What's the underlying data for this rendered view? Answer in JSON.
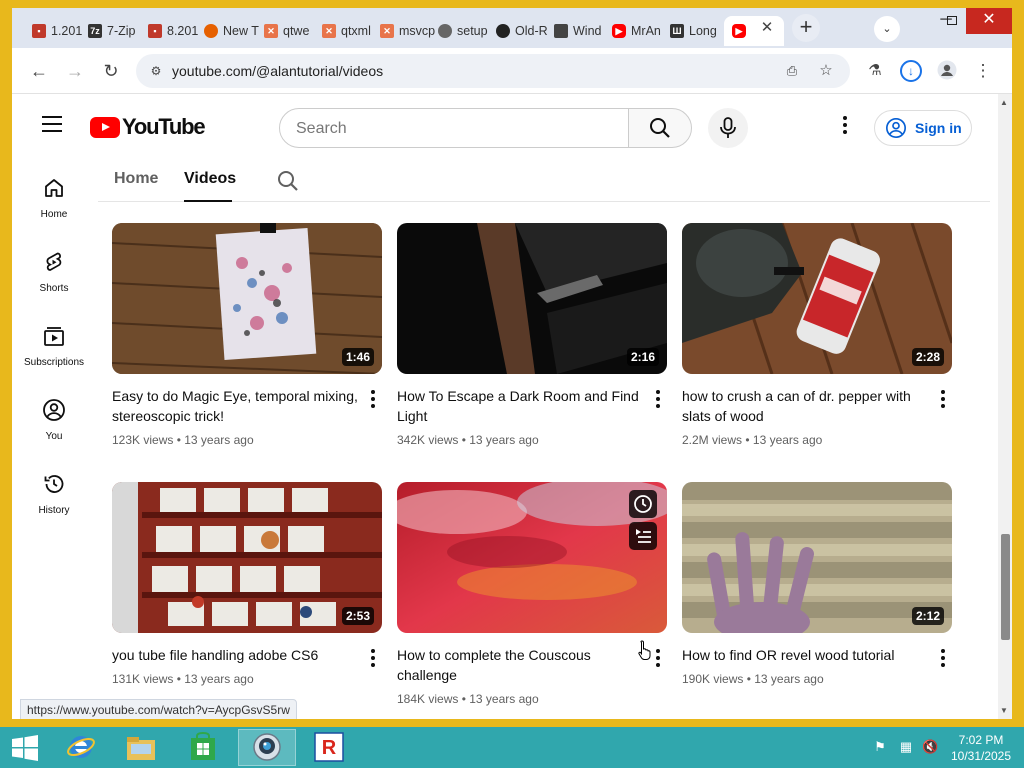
{
  "browser": {
    "tabs": [
      {
        "title": "1.201",
        "icon": "app-icon",
        "color": "#c0392b"
      },
      {
        "title": "7-Zip",
        "icon": "7zip-icon",
        "color": "#333333"
      },
      {
        "title": "8.201",
        "icon": "app-icon",
        "color": "#c0392b"
      },
      {
        "title": "New T",
        "icon": "firefox-icon",
        "color": "#e66000"
      },
      {
        "title": "qtwe",
        "icon": "package-icon",
        "color": "#e8744a"
      },
      {
        "title": "qtxml",
        "icon": "package-icon",
        "color": "#e8744a"
      },
      {
        "title": "msvcp",
        "icon": "package-icon",
        "color": "#e8744a"
      },
      {
        "title": "setup",
        "icon": "globe-icon",
        "color": "#666666"
      },
      {
        "title": "Old-R",
        "icon": "github-icon",
        "color": "#222222"
      },
      {
        "title": "Wind",
        "icon": "wayback-icon",
        "color": "#444444"
      },
      {
        "title": "MrAn",
        "icon": "youtube-icon",
        "color": "#ff0000"
      },
      {
        "title": "Long",
        "icon": "archive-icon",
        "color": "#333333"
      }
    ],
    "active_tab_icon": "youtube-icon",
    "new_tab_label": "+",
    "tab_search_label": "⌄",
    "url": "youtube.com/@alantutorial/videos",
    "status_url": "https://www.youtube.com/watch?v=AycpGsvS5rw"
  },
  "youtube": {
    "logo_text": "YouTube",
    "search_placeholder": "Search",
    "sign_in": "Sign in",
    "nav": [
      {
        "label": "Home",
        "icon": "home-icon"
      },
      {
        "label": "Shorts",
        "icon": "shorts-icon"
      },
      {
        "label": "Subscriptions",
        "icon": "subscriptions-icon"
      },
      {
        "label": "You",
        "icon": "you-icon"
      },
      {
        "label": "History",
        "icon": "history-icon"
      }
    ],
    "channel_tabs": [
      "Home",
      "Videos"
    ],
    "videos": [
      {
        "title": "Easy to do Magic Eye, temporal mixing, stereoscopic trick!",
        "views": "123K views",
        "age": "13 years ago",
        "duration": "1:46"
      },
      {
        "title": "How To Escape a Dark Room and Find Light",
        "views": "342K views",
        "age": "13 years ago",
        "duration": "2:16"
      },
      {
        "title": "how to crush a can of dr. pepper with slats of wood",
        "views": "2.2M views",
        "age": "13 years ago",
        "duration": "2:28"
      },
      {
        "title": "you tube file handling adobe CS6",
        "views": "131K views",
        "age": "13 years ago",
        "duration": "2:53"
      },
      {
        "title": "How to complete the Couscous challenge",
        "views": "184K views",
        "age": "13 years ago",
        "duration": ""
      },
      {
        "title": "How to find OR revel wood tutorial",
        "views": "190K views",
        "age": "13 years ago",
        "duration": "2:12"
      }
    ],
    "meta_separator": " • "
  },
  "taskbar": {
    "items": [
      "start-icon",
      "internet-explorer-icon",
      "file-explorer-icon",
      "store-icon",
      "app-camera-icon",
      "roblox-icon"
    ],
    "time": "7:02 PM",
    "date": "10/31/2025"
  },
  "colors": {
    "accent": "#065fd4",
    "youtube_red": "#ff0000",
    "taskbar": "#30a7ad",
    "window_frame": "#e8b81c"
  }
}
